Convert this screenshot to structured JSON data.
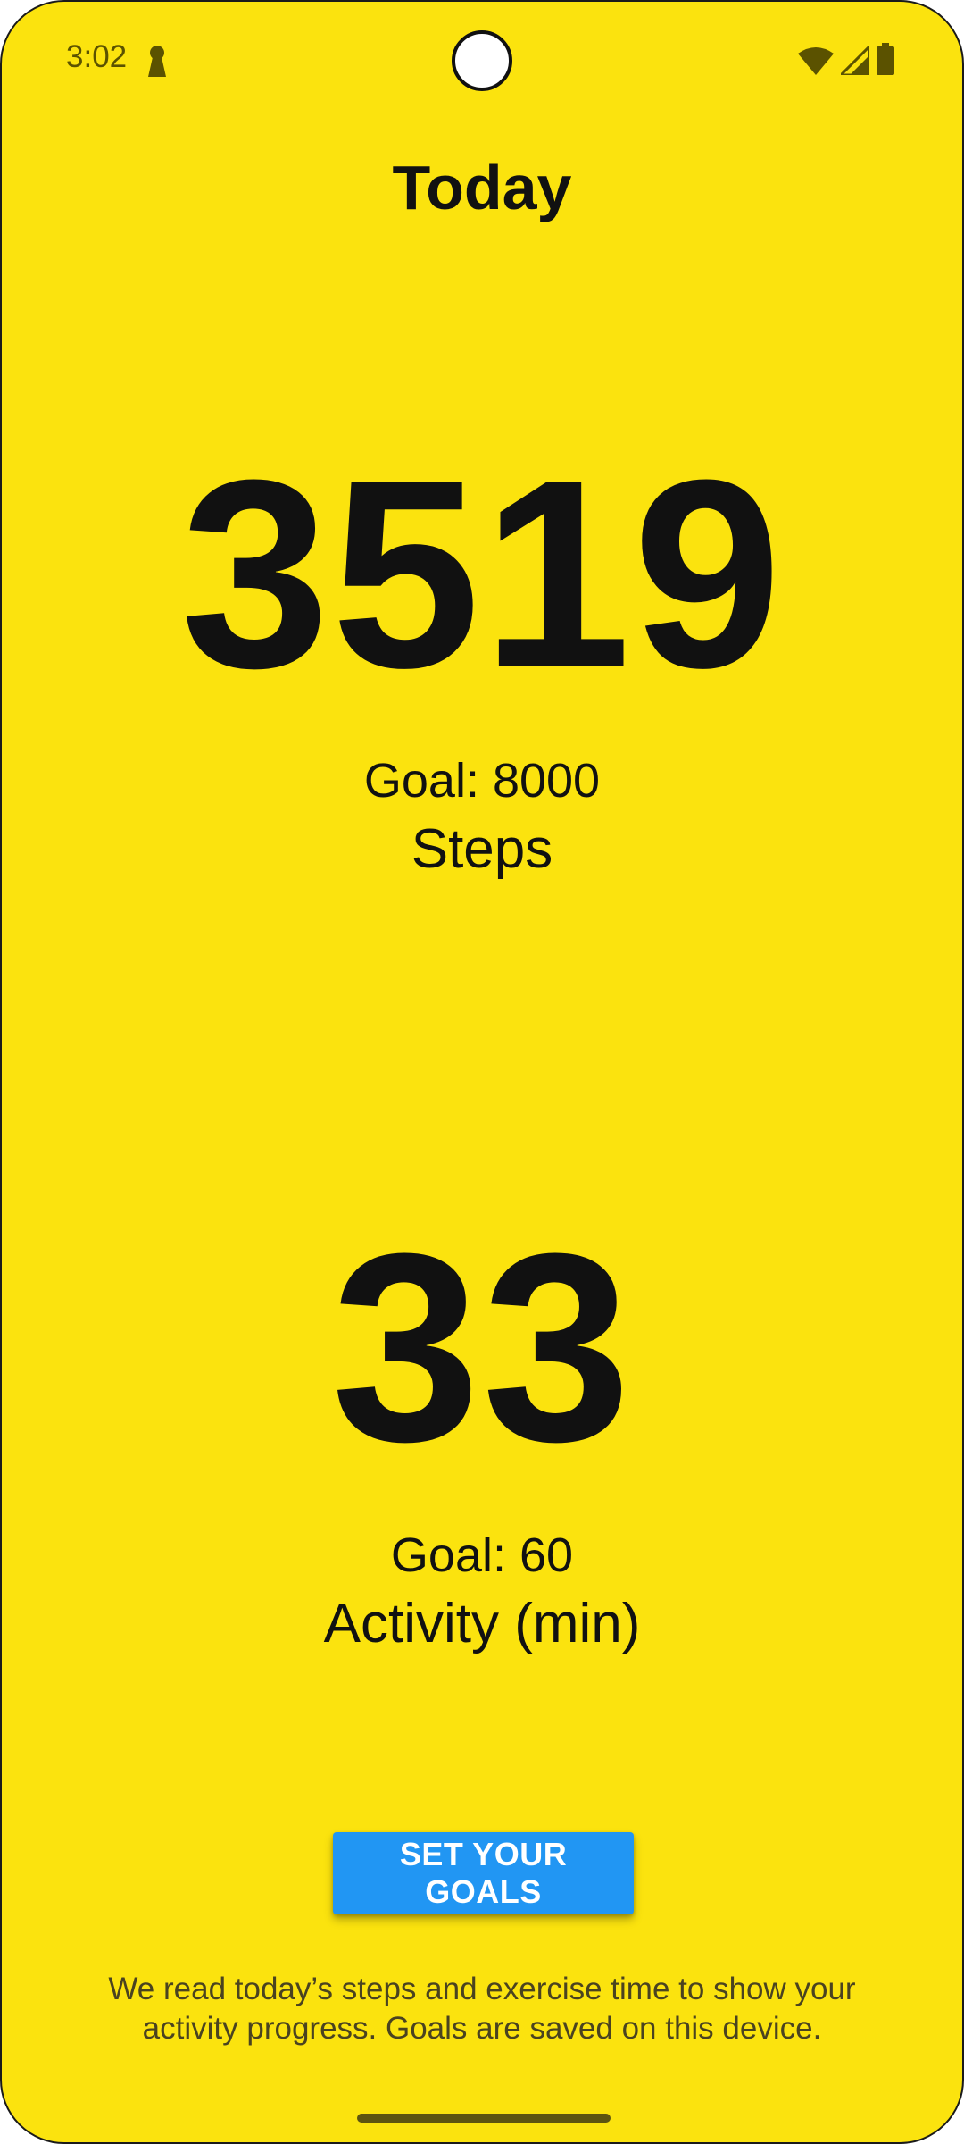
{
  "status_bar": {
    "time": "3:02",
    "icons": [
      "lock-icon",
      "wifi-icon",
      "cellular-signal-icon",
      "battery-icon"
    ]
  },
  "page": {
    "title": "Today"
  },
  "steps": {
    "value": "3519",
    "goal": "Goal: 8000",
    "label": "Steps"
  },
  "activity": {
    "value": "33",
    "goal": "Goal: 60",
    "label": "Activity (min)"
  },
  "actions": {
    "set_goals_label": "SET YOUR GOALS"
  },
  "footer": {
    "note": "We read today’s steps and exercise time to show your activity progress. Goals are saved on this device."
  },
  "colors": {
    "background": "#FBE30E",
    "button": "#2196F3",
    "text": "#111111"
  }
}
